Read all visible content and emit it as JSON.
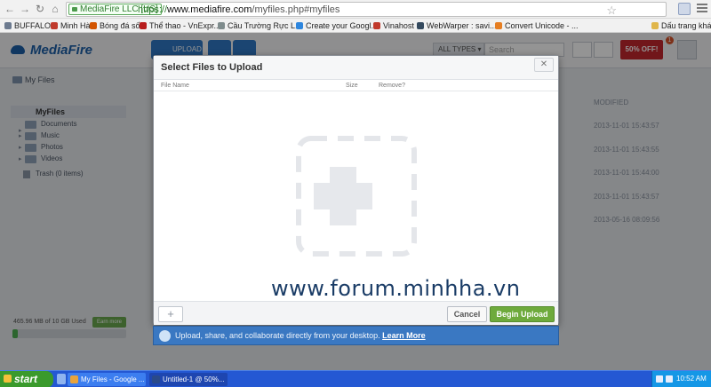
{
  "browser": {
    "security_label": "MediaFire LLC [US]",
    "url_scheme": "https://",
    "url_host": "www.mediafire.com",
    "url_path": "/myfiles.php#myfiles",
    "bookmarks": [
      {
        "label": "BUFFALO",
        "color": "#6c7a8f"
      },
      {
        "label": "Minh Hà",
        "color": "#c0392b"
      },
      {
        "label": "Bóng đá số",
        "color": "#d35400"
      },
      {
        "label": "Thể thao - VnExpr...",
        "color": "#b71c1c"
      },
      {
        "label": "Cầu Trường Rực L...",
        "color": "#7f8c8d"
      },
      {
        "label": "Create your Googl...",
        "color": "#2e86de"
      },
      {
        "label": "Vinahost",
        "color": "#c0392b"
      },
      {
        "label": "WebWarper : savi...",
        "color": "#34495e"
      },
      {
        "label": "Convert Unicode - ...",
        "color": "#e67e22"
      }
    ],
    "bookmarks_other": "Dấu trang khác"
  },
  "header": {
    "logo": "MediaFire",
    "upload_label": "UPLOAD",
    "types_label": "ALL TYPES ▾",
    "search_placeholder": "Search",
    "promo_label": "50% OFF!",
    "notification_count": "1"
  },
  "breadcrumb": "My Files",
  "sidebar": {
    "root": "MyFiles",
    "items": [
      "Documents",
      "Music",
      "Photos",
      "Videos"
    ],
    "trash": "Trash (0 items)",
    "storage_text": "465.96 MB of 10 GB Used",
    "upgrade_label": "Earn more",
    "storage_used_fraction": 0.046
  },
  "background_dates": [
    "MODIFIED",
    "2013-11-01 15:43:57",
    "2013-11-01 15:43:55",
    "2013-11-01 15:44:00",
    "2013-11-01 15:43:57",
    "2013-05-16 08:09:56"
  ],
  "modal": {
    "title": "Select Files to Upload",
    "col_filename": "File Name",
    "col_size": "Size",
    "col_remove": "Remove?",
    "cancel_label": "Cancel",
    "begin_label": "Begin Upload"
  },
  "desktop_promo": {
    "text": "Upload, share, and collaborate directly from your desktop.",
    "link": "Learn More"
  },
  "watermark": "www.forum.minhha.vn",
  "taskbar": {
    "start_label": "start",
    "tasks": [
      {
        "label": "My Files - Google ...",
        "color": "#e8a33c"
      },
      {
        "label": "Untitled-1 @ 50%...",
        "color": "#2a4a8a"
      }
    ],
    "clock": "10:52 AM"
  },
  "colors": {
    "accent": "#2f78c4",
    "begin_upload": "#6eaa3c",
    "promo": "#c3272e",
    "taskbar": "#2458d3"
  }
}
